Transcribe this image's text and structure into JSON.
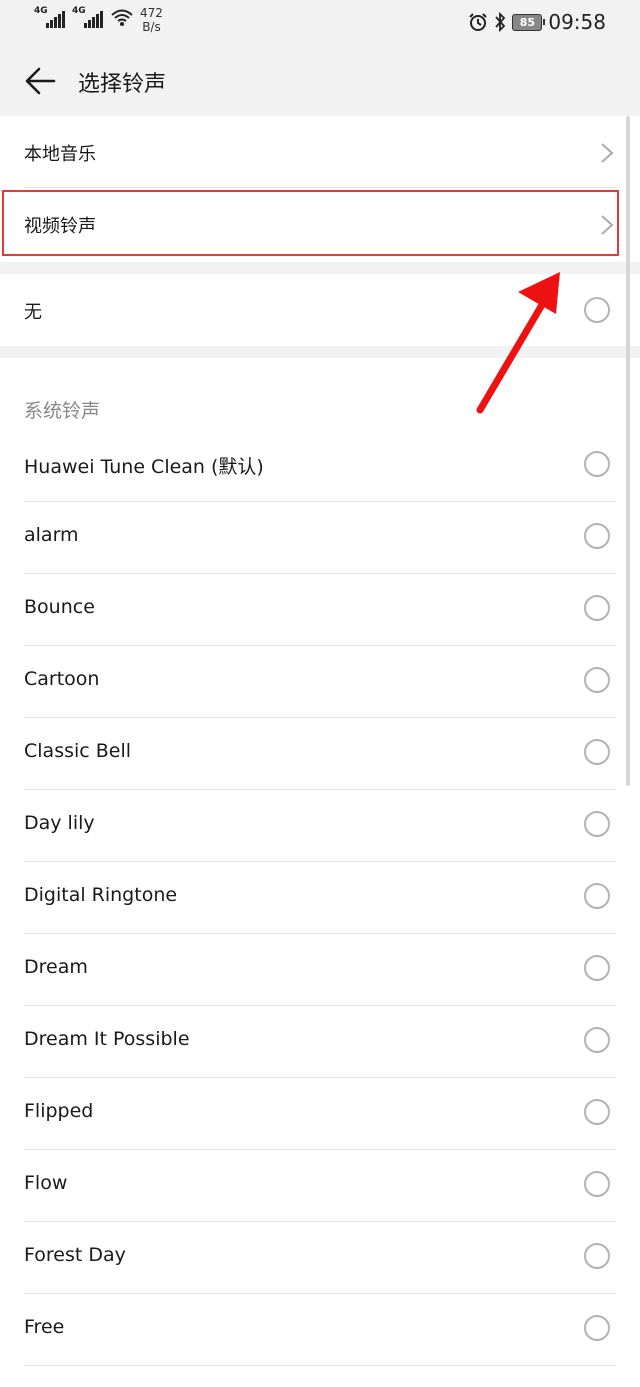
{
  "status_bar": {
    "signal1": "4G",
    "signal2": "4G",
    "speed_value": "472",
    "speed_unit": "B/s",
    "battery": "85",
    "time": "09:58"
  },
  "header": {
    "title": "选择铃声"
  },
  "nav_items": [
    {
      "label": "本地音乐"
    },
    {
      "label": "视频铃声"
    }
  ],
  "none_option": {
    "label": "无"
  },
  "system": {
    "title": "系统铃声",
    "items": [
      "Huawei Tune Clean (默认)",
      "alarm",
      "Bounce",
      "Cartoon",
      "Classic Bell",
      "Day lily",
      "Digital Ringtone",
      "Dream",
      "Dream It Possible",
      "Flipped",
      "Flow",
      "Forest Day",
      "Free"
    ]
  },
  "colors": {
    "highlight": "#e23a3a",
    "arrow": "#ee1111",
    "background": "#f2f2f2"
  }
}
